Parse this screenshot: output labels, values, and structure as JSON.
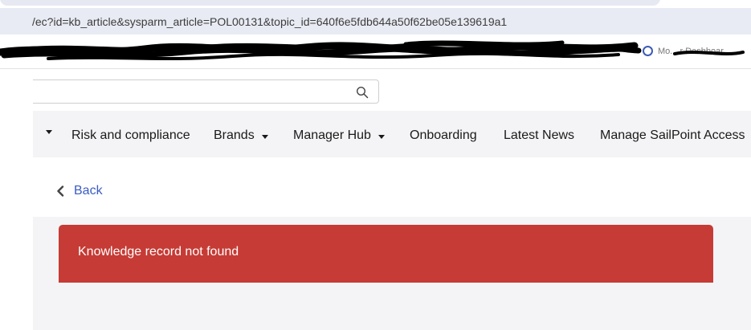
{
  "browser": {
    "url": "/ec?id=kb_article&sysparm_article=POL00131&topic_id=640f6e5fdb644a50f62be05e139619a1",
    "bookmark_right_label": "Mo... r Dashboar..."
  },
  "search": {
    "value": "",
    "placeholder": "",
    "icon": "search-icon"
  },
  "nav": {
    "items": [
      {
        "label": "",
        "has_caret": true
      },
      {
        "label": "Risk and compliance",
        "has_caret": false
      },
      {
        "label": "Brands",
        "has_caret": true
      },
      {
        "label": "Manager Hub",
        "has_caret": true
      },
      {
        "label": "Onboarding",
        "has_caret": false
      },
      {
        "label": "Latest News",
        "has_caret": false
      },
      {
        "label": "Manage SailPoint Access",
        "has_caret": false
      }
    ]
  },
  "back": {
    "label": "Back",
    "icon": "chevron-left-icon"
  },
  "alert": {
    "message": "Knowledge record not found",
    "color": "#c63b35"
  },
  "colors": {
    "link": "#3b5bc4",
    "page_bg": "#f4f4f6",
    "address_bar": "#e9ebf4"
  }
}
